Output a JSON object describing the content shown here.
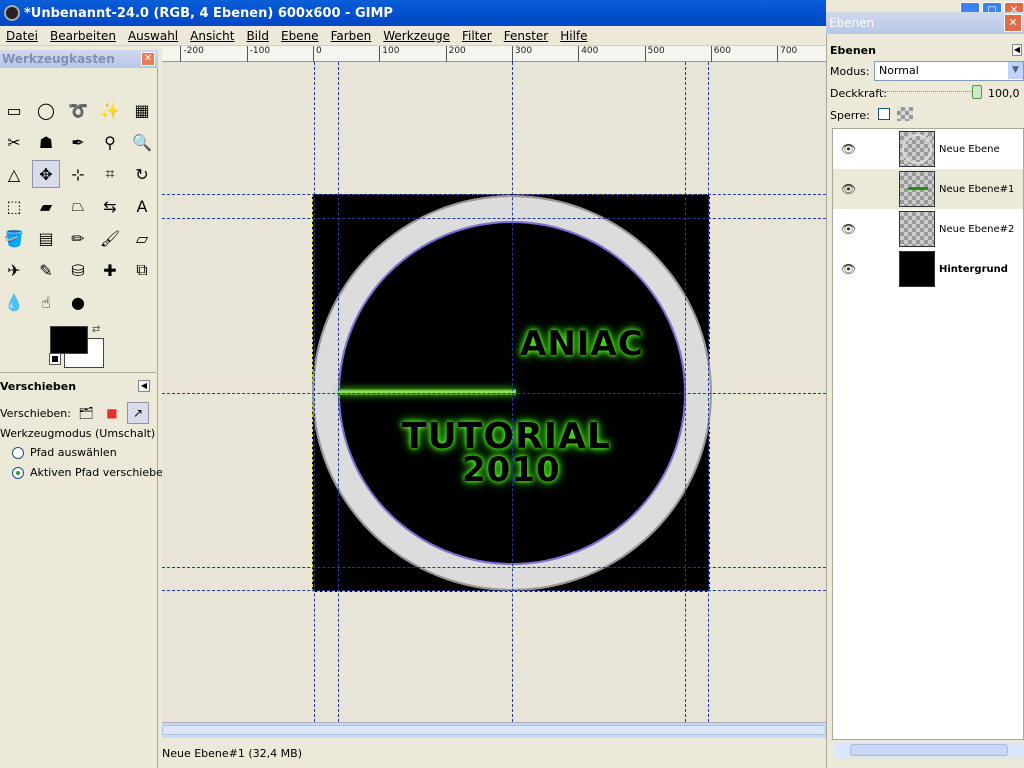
{
  "window": {
    "title": "*Unbenannt-24.0 (RGB, 4 Ebenen) 600x600 - GIMP"
  },
  "menubar": [
    "Datei",
    "Bearbeiten",
    "Auswahl",
    "Ansicht",
    "Bild",
    "Ebene",
    "Farben",
    "Werkzeuge",
    "Filter",
    "Fenster",
    "Hilfe"
  ],
  "toolbox": {
    "title": "Werkzeugkasten",
    "tools": [
      {
        "icon": "rect-select-icon",
        "glyph": "▭"
      },
      {
        "icon": "ellipse-select-icon",
        "glyph": "◯"
      },
      {
        "icon": "free-select-icon",
        "glyph": "➰"
      },
      {
        "icon": "fuzzy-select-icon",
        "glyph": "✨"
      },
      {
        "icon": "color-select-icon",
        "glyph": "▦"
      },
      {
        "icon": "scissors-icon",
        "glyph": "✂"
      },
      {
        "icon": "foreground-select-icon",
        "glyph": "☗"
      },
      {
        "icon": "paths-icon",
        "glyph": "✒"
      },
      {
        "icon": "color-picker-icon",
        "glyph": "⚲"
      },
      {
        "icon": "zoom-icon",
        "glyph": "🔍"
      },
      {
        "icon": "measure-icon",
        "glyph": "△"
      },
      {
        "icon": "move-icon",
        "glyph": "✥"
      },
      {
        "icon": "align-icon",
        "glyph": "⊹"
      },
      {
        "icon": "crop-icon",
        "glyph": "⌗"
      },
      {
        "icon": "rotate-icon",
        "glyph": "↻"
      },
      {
        "icon": "scale-icon",
        "glyph": "⬚"
      },
      {
        "icon": "shear-icon",
        "glyph": "▰"
      },
      {
        "icon": "perspective-icon",
        "glyph": "⏢"
      },
      {
        "icon": "flip-icon",
        "glyph": "⇆"
      },
      {
        "icon": "text-icon",
        "glyph": "A"
      },
      {
        "icon": "bucket-fill-icon",
        "glyph": "🪣"
      },
      {
        "icon": "blend-icon",
        "glyph": "▤"
      },
      {
        "icon": "pencil-icon",
        "glyph": "✏"
      },
      {
        "icon": "paintbrush-icon",
        "glyph": "🖌"
      },
      {
        "icon": "eraser-icon",
        "glyph": "▱"
      },
      {
        "icon": "airbrush-icon",
        "glyph": "✈"
      },
      {
        "icon": "ink-icon",
        "glyph": "✎"
      },
      {
        "icon": "clone-icon",
        "glyph": "⛁"
      },
      {
        "icon": "heal-icon",
        "glyph": "✚"
      },
      {
        "icon": "perspective-clone-icon",
        "glyph": "⧉"
      },
      {
        "icon": "blur-icon",
        "glyph": "💧"
      },
      {
        "icon": "smudge-icon",
        "glyph": "☝"
      },
      {
        "icon": "dodge-burn-icon",
        "glyph": "●"
      }
    ],
    "activeToolIndex": 11
  },
  "tool_options": {
    "title": "Verschieben",
    "move_label": "Verschieben:",
    "mode_label": "Werkzeugmodus (Umschalt)",
    "radio_options": [
      "Pfad auswählen",
      "Aktiven Pfad verschieben"
    ],
    "selected_radio": 1
  },
  "ruler": {
    "ticks": [
      "-200",
      "-100",
      "0",
      "100",
      "200",
      "300",
      "400",
      "500",
      "600",
      "700"
    ]
  },
  "canvas": {
    "text_maniac": "ANIAC",
    "text_tutorial": "TUTORIAL",
    "text_year": "2010"
  },
  "status": {
    "text": "Neue Ebene#1 (32,4 MB)"
  },
  "layers": {
    "title": "Ebenen",
    "heading": "Ebenen",
    "mode_label": "Modus:",
    "mode_value": "Normal",
    "opacity_label": "Deckkraft:",
    "opacity_value": "100,0",
    "lock_label": "Sperre:",
    "items": [
      {
        "name": "Neue Ebene",
        "thumb": "ring",
        "bold": false,
        "selected": false
      },
      {
        "name": "Neue Ebene#1",
        "thumb": "bar",
        "bold": false,
        "selected": true
      },
      {
        "name": "Neue Ebene#2",
        "thumb": "trans",
        "bold": false,
        "selected": false
      },
      {
        "name": "Hintergrund",
        "thumb": "black",
        "bold": true,
        "selected": false
      }
    ]
  }
}
